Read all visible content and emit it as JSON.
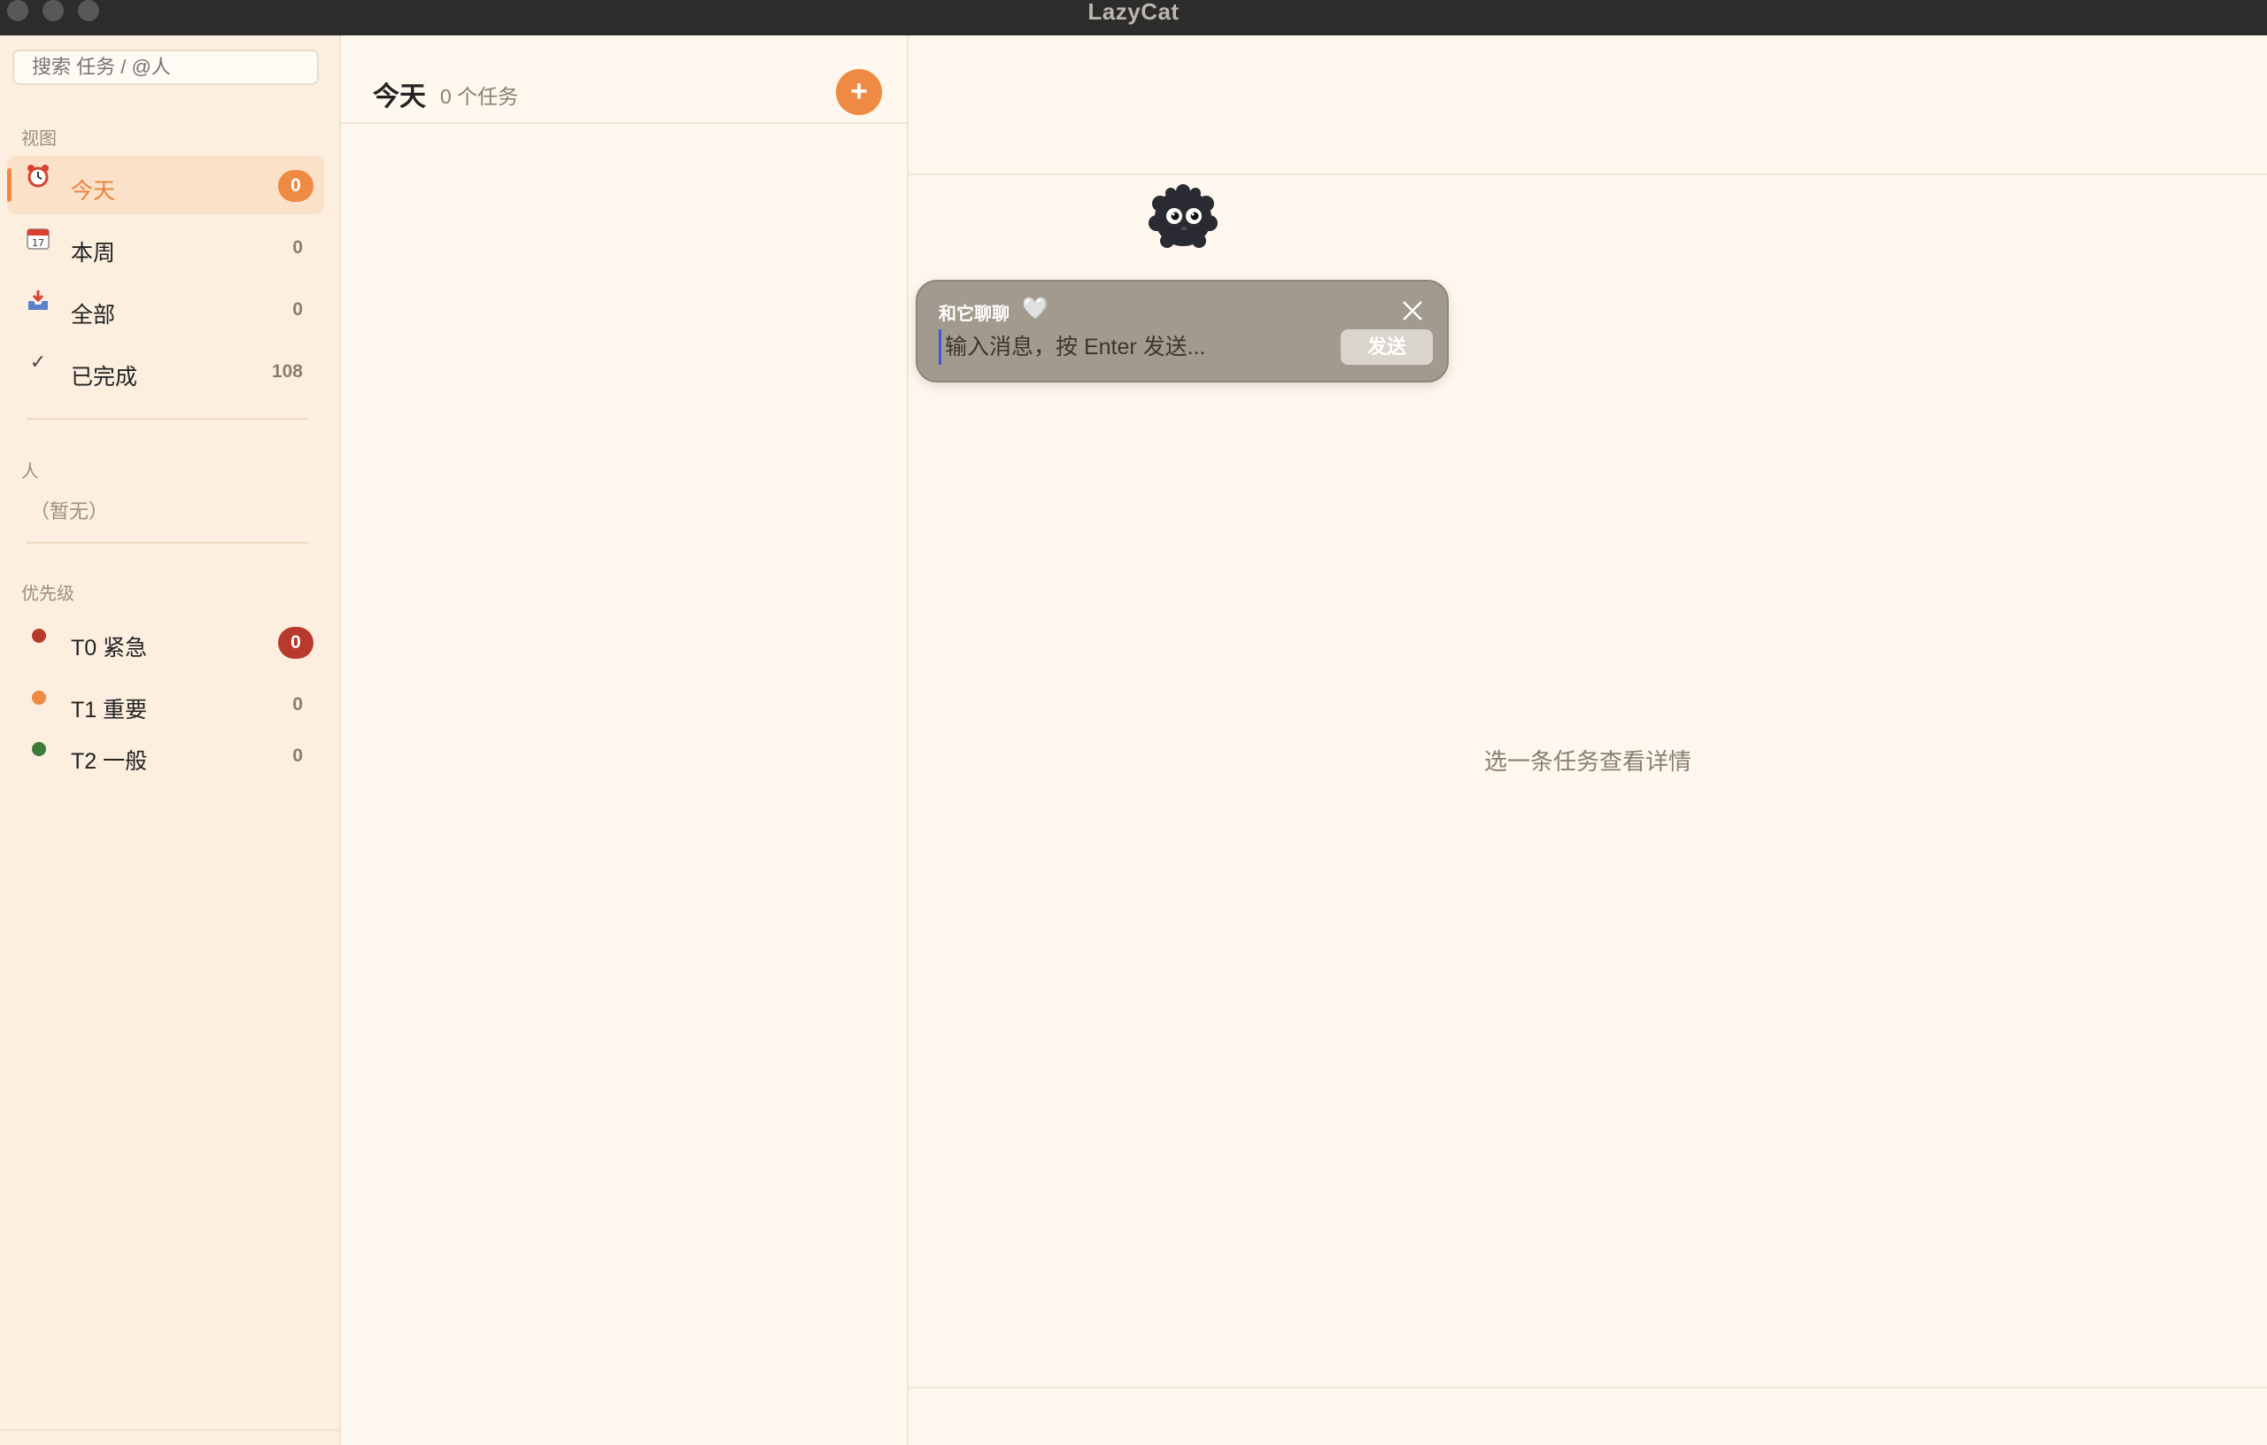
{
  "window": {
    "title": "LazyCat"
  },
  "sidebar": {
    "search_placeholder": "搜索 任务 / @人",
    "views_label": "视图",
    "views": [
      {
        "icon": "alarm-clock-icon",
        "label": "今天",
        "count": "0",
        "active": true
      },
      {
        "icon": "calendar-icon",
        "label": "本周",
        "count": "0"
      },
      {
        "icon": "inbox-tray-icon",
        "label": "全部",
        "count": "0"
      },
      {
        "icon": "checkmark-icon",
        "label": "已完成",
        "count": "108"
      }
    ],
    "people_label": "人",
    "people_empty": "（暂无）",
    "priority_label": "优先级",
    "priorities": [
      {
        "label": "T0 紧急",
        "count": "0",
        "color": "#b83a2f"
      },
      {
        "label": "T1 重要",
        "count": "0",
        "color": "#ee8a43"
      },
      {
        "label": "T2 一般",
        "count": "0",
        "color": "#3e7b3a"
      }
    ]
  },
  "list": {
    "title": "今天",
    "count_text": "0 个任务",
    "add_label": "+"
  },
  "detail": {
    "empty_message": "选一条任务查看详情"
  },
  "chat": {
    "title": "和它聊聊",
    "heart": "🤍",
    "input_placeholder": "输入消息，按 Enter 发送...",
    "send_label": "发送"
  },
  "colors": {
    "accent": "#ee8a43",
    "danger": "#b83a2f",
    "success": "#3e7b3a",
    "background": "#fef7ed"
  }
}
